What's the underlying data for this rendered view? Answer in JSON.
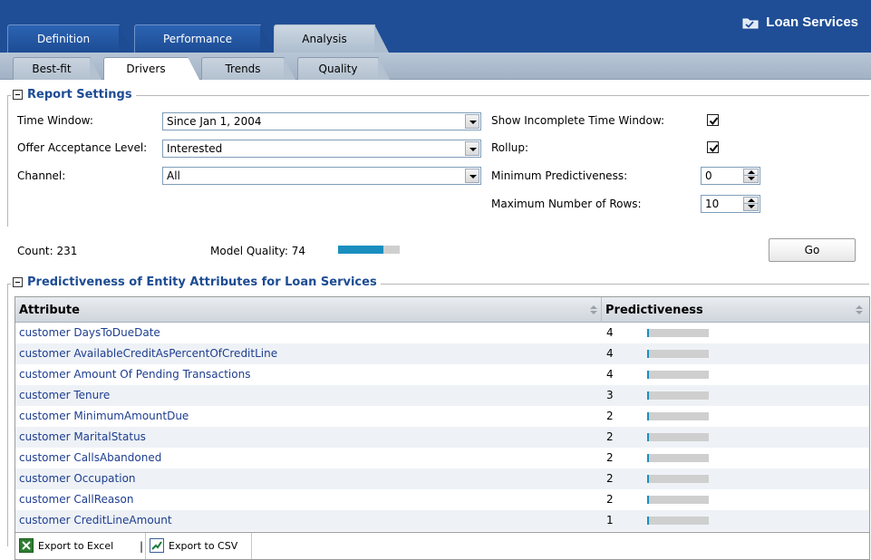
{
  "brand": {
    "title": "Loan Services"
  },
  "main_tabs": [
    {
      "label": "Definition",
      "active": false
    },
    {
      "label": "Performance",
      "active": false
    },
    {
      "label": "Analysis",
      "active": true
    }
  ],
  "sub_tabs": [
    {
      "label": "Best-fit",
      "active": false
    },
    {
      "label": "Drivers",
      "active": true
    },
    {
      "label": "Trends",
      "active": false
    },
    {
      "label": "Quality",
      "active": false
    }
  ],
  "report_settings": {
    "title": "Report Settings",
    "time_window_label": "Time Window:",
    "time_window_value": "Since Jan 1, 2004",
    "offer_label": "Offer Acceptance Level:",
    "offer_value": "Interested",
    "channel_label": "Channel:",
    "channel_value": "All",
    "incomplete_label": "Show Incomplete Time Window:",
    "incomplete_checked": true,
    "rollup_label": "Rollup:",
    "rollup_checked": true,
    "min_pred_label": "Minimum Predictiveness:",
    "min_pred_value": "0",
    "max_rows_label": "Maximum Number of Rows:",
    "max_rows_value": "10"
  },
  "summary": {
    "count_text": "Count: 231",
    "quality_text": "Model Quality: 74",
    "quality_fraction": 0.74,
    "go_label": "Go"
  },
  "predictiveness": {
    "title": "Predictiveness of Entity Attributes for Loan Services",
    "col_attribute": "Attribute",
    "col_predictiveness": "Predictiveness",
    "max_scale": 100,
    "rows": [
      {
        "attribute": "customer DaysToDueDate",
        "value": 4
      },
      {
        "attribute": "customer AvailableCreditAsPercentOfCreditLine",
        "value": 4
      },
      {
        "attribute": "customer Amount Of Pending Transactions",
        "value": 4
      },
      {
        "attribute": "customer Tenure",
        "value": 3
      },
      {
        "attribute": "customer MinimumAmountDue",
        "value": 2
      },
      {
        "attribute": "customer MaritalStatus",
        "value": 2
      },
      {
        "attribute": "customer CallsAbandoned",
        "value": 2
      },
      {
        "attribute": "customer Occupation",
        "value": 2
      },
      {
        "attribute": "customer CallReason",
        "value": 2
      },
      {
        "attribute": "customer CreditLineAmount",
        "value": 1
      }
    ]
  },
  "export": {
    "excel_label": "Export to Excel",
    "separator": "|",
    "csv_label": "Export to CSV"
  },
  "colors": {
    "header_blue": "#1f4e96",
    "bar_fill": "#1a8fbf",
    "bar_track": "#cfcfcf",
    "link": "#1d3d8f"
  }
}
